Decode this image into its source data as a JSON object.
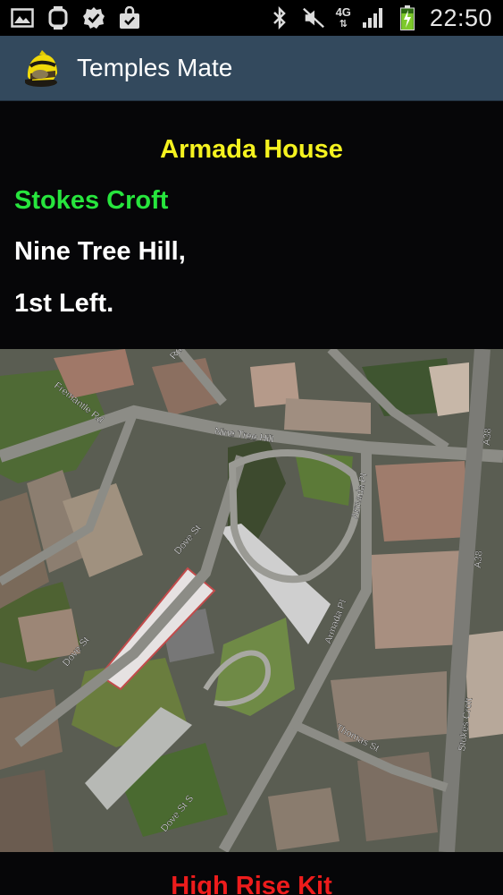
{
  "app": {
    "title": "Temples Mate"
  },
  "status_bar": {
    "time": "22:50",
    "network": "4G",
    "icons": [
      "gallery-icon",
      "watch-icon",
      "badge-check-icon",
      "shopping-bag-icon",
      "bluetooth-icon",
      "mute-icon",
      "signal-icon",
      "battery-charging-icon"
    ]
  },
  "location": {
    "building": "Armada House",
    "area": "Stokes Croft",
    "directions": [
      "Nine Tree Hill,",
      "1st Left."
    ]
  },
  "map": {
    "street_labels": [
      "Fremantle Rd",
      "Nine Tree Hill",
      "Armada Pl",
      "Dove St",
      "Dove St",
      "Armada Pl",
      "A38",
      "A38",
      "Stokes Croft",
      "Thomas St",
      "Dove St S",
      "Rd"
    ]
  },
  "kit": {
    "label": "High Rise Kit"
  },
  "colors": {
    "app_bar": "#33495d",
    "building": "#f5f21f",
    "area": "#27e53d",
    "directions": "#ffffff",
    "kit": "#ee1c1c",
    "background": "#060608"
  }
}
